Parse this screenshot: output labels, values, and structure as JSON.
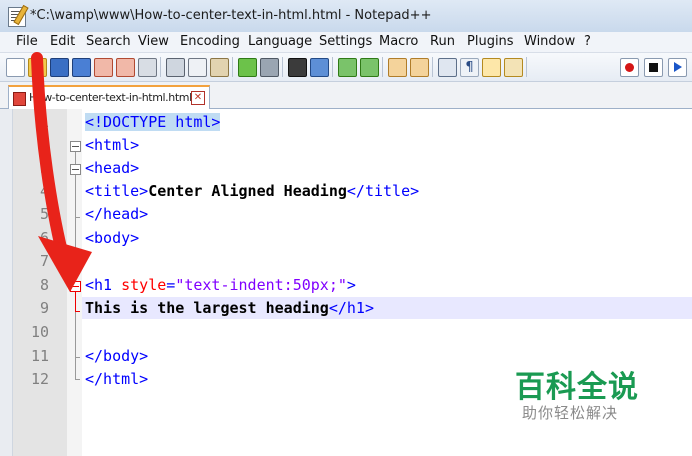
{
  "window": {
    "title": "*C:\\wamp\\www\\How-to-center-text-in-html.html - Notepad++"
  },
  "menu": [
    "File",
    "Edit",
    "Search",
    "View",
    "Encoding",
    "Language",
    "Settings",
    "Macro",
    "Run",
    "Plugins",
    "Window",
    "?"
  ],
  "toolbar": {
    "icons": [
      "new-file-icon",
      "open-file-icon",
      "save-icon",
      "save-all-icon",
      "close-icon",
      "close-all-icon",
      "print-icon",
      "cut-icon",
      "copy-icon",
      "paste-icon",
      "undo-icon",
      "redo-icon",
      "find-icon",
      "replace-icon",
      "zoom-in-icon",
      "zoom-out-icon",
      "sync-vertical-icon",
      "sync-horizontal-icon",
      "word-wrap-icon",
      "show-all-characters-icon",
      "indent-guide-icon",
      "doc-map-icon",
      "record-macro-icon",
      "stop-record-icon",
      "play-macro-icon"
    ]
  },
  "tab": {
    "label": "How-to-center-text-in-html.html",
    "close": "✕"
  },
  "editor": {
    "line_numbers": [
      "1",
      "2",
      "3",
      "4",
      "5",
      "6",
      "7",
      "8",
      "9",
      "10",
      "11",
      "12"
    ],
    "lines": [
      {
        "parts": [
          [
            "t",
            "<!DOCTYPE html>"
          ]
        ]
      },
      {
        "parts": [
          [
            "t",
            "<html>"
          ]
        ]
      },
      {
        "parts": [
          [
            "t",
            "<head>"
          ]
        ]
      },
      {
        "parts": [
          [
            "t",
            "<title>"
          ],
          [
            "tx",
            "Center Aligned Heading"
          ],
          [
            "t",
            "</title>"
          ]
        ]
      },
      {
        "parts": [
          [
            "t",
            "</head>"
          ]
        ]
      },
      {
        "parts": [
          [
            "t",
            "<body>"
          ]
        ]
      },
      {
        "parts": []
      },
      {
        "parts": [
          [
            "t",
            "<h1 "
          ],
          [
            "a",
            "style"
          ],
          [
            "t",
            "="
          ],
          [
            "s",
            "\"text-indent:50px;\""
          ],
          [
            "t",
            ">"
          ]
        ]
      },
      {
        "parts": [
          [
            "tx",
            "This is the largest heading"
          ],
          [
            "t",
            "</h1>"
          ]
        ]
      },
      {
        "parts": []
      },
      {
        "parts": [
          [
            "t",
            "</body>"
          ]
        ]
      },
      {
        "parts": [
          [
            "t",
            "</html>"
          ]
        ]
      }
    ]
  },
  "watermark": {
    "brand": "百科全说",
    "tagline": "助你轻松解决"
  },
  "colors": {
    "arrow": "#e8231a",
    "tag": "#0000ff",
    "attr": "#ff0000",
    "string": "#8000ff",
    "current_line": "#e8e8ff"
  }
}
